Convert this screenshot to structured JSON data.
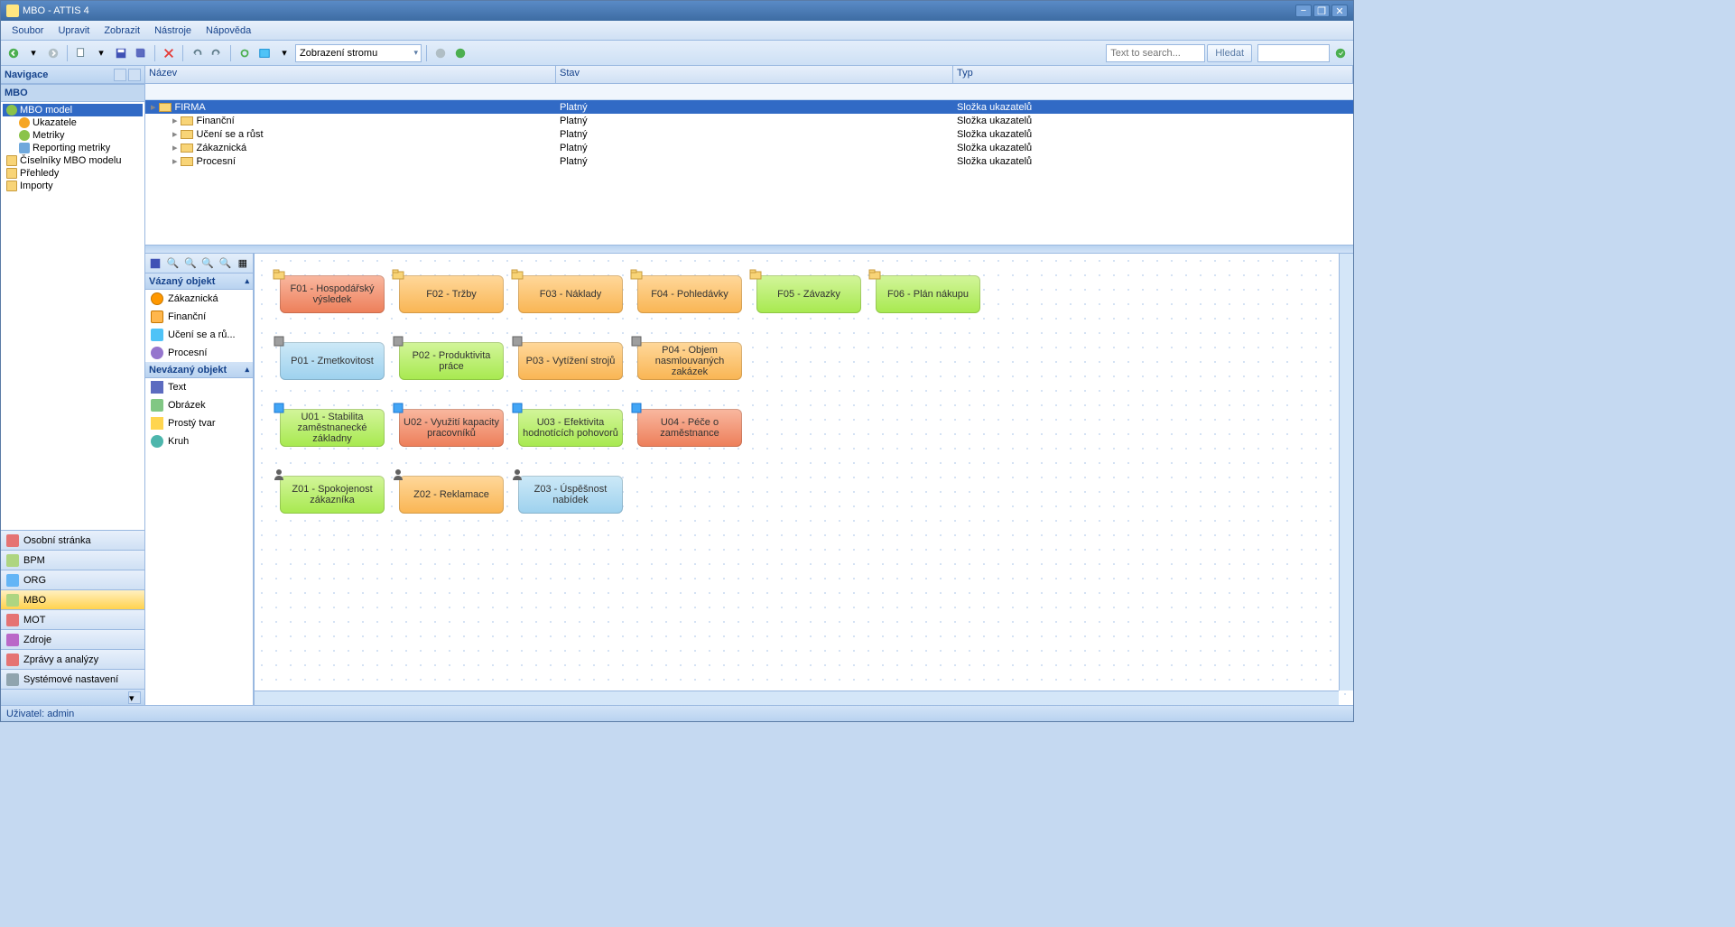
{
  "title": "MBO - ATTIS 4",
  "menu": [
    "Soubor",
    "Upravit",
    "Zobrazit",
    "Nástroje",
    "Nápověda"
  ],
  "toolbar": {
    "view_select": "Zobrazení stromu",
    "search_placeholder": "Text to search...",
    "search_btn": "Hledat"
  },
  "nav": {
    "title": "Navigace",
    "section": "MBO",
    "tree": [
      {
        "label": "MBO model",
        "selected": true,
        "indent": 0,
        "icon": "grn"
      },
      {
        "label": "Ukazatele",
        "indent": 1,
        "icon": "org"
      },
      {
        "label": "Metriky",
        "indent": 1,
        "icon": "grn"
      },
      {
        "label": "Reporting metriky",
        "indent": 1,
        "icon": "blu"
      },
      {
        "label": "Číselníky MBO modelu",
        "indent": 0,
        "icon": "fld"
      },
      {
        "label": "Přehledy",
        "indent": 0,
        "icon": "fld"
      },
      {
        "label": "Importy",
        "indent": 0,
        "icon": "fld"
      }
    ],
    "buttons": [
      {
        "label": "Osobní stránka",
        "icon": "r"
      },
      {
        "label": "BPM",
        "icon": "g"
      },
      {
        "label": "ORG",
        "icon": "b"
      },
      {
        "label": "MBO",
        "icon": "g",
        "selected": true
      },
      {
        "label": "MOT",
        "icon": "r"
      },
      {
        "label": "Zdroje",
        "icon": "p"
      },
      {
        "label": "Zprávy a analýzy",
        "icon": "r"
      },
      {
        "label": "Systémové nastavení",
        "icon": "gr"
      }
    ]
  },
  "grid": {
    "cols": [
      "Název",
      "Stav",
      "Typ"
    ],
    "rows": [
      {
        "name": "FIRMA",
        "stav": "Platný",
        "typ": "Složka ukazatelů",
        "indent": 0,
        "selected": true
      },
      {
        "name": "Finanční",
        "stav": "Platný",
        "typ": "Složka ukazatelů",
        "indent": 1
      },
      {
        "name": "Učení se a růst",
        "stav": "Platný",
        "typ": "Složka ukazatelů",
        "indent": 1
      },
      {
        "name": "Zákaznická",
        "stav": "Platný",
        "typ": "Složka ukazatelů",
        "indent": 1
      },
      {
        "name": "Procesní",
        "stav": "Platný",
        "typ": "Složka ukazatelů",
        "indent": 1
      }
    ]
  },
  "toolbox": {
    "bound_title": "Vázaný objekt",
    "bound": [
      "Zákaznická",
      "Finanční",
      "Učení se a rů...",
      "Procesní"
    ],
    "unbound_title": "Nevázaný objekt",
    "unbound": [
      "Text",
      "Obrázek",
      "Prostý tvar",
      "Kruh"
    ]
  },
  "cards": [
    {
      "label": "F01 - Hospodářský výsledek",
      "color": "c-red",
      "row": 0,
      "col": 0,
      "badge": "fld"
    },
    {
      "label": "F02 - Tržby",
      "color": "c-orange",
      "row": 0,
      "col": 1,
      "badge": "fld"
    },
    {
      "label": "F03 - Náklady",
      "color": "c-orange",
      "row": 0,
      "col": 2,
      "badge": "fld"
    },
    {
      "label": "F04 - Pohledávky",
      "color": "c-orange",
      "row": 0,
      "col": 3,
      "badge": "fld"
    },
    {
      "label": "F05 - Závazky",
      "color": "c-green",
      "row": 0,
      "col": 4,
      "badge": "fld"
    },
    {
      "label": "F06 - Plán nákupu",
      "color": "c-green",
      "row": 0,
      "col": 5,
      "badge": "fld"
    },
    {
      "label": "P01 - Zmetkovitost",
      "color": "c-blue",
      "row": 1,
      "col": 0,
      "badge": "box"
    },
    {
      "label": "P02 - Produktivita práce",
      "color": "c-green",
      "row": 1,
      "col": 1,
      "badge": "box"
    },
    {
      "label": "P03 - Vytížení strojů",
      "color": "c-orange",
      "row": 1,
      "col": 2,
      "badge": "box"
    },
    {
      "label": "P04 - Objem nasmlouvaných zakázek",
      "color": "c-orange",
      "row": 1,
      "col": 3,
      "badge": "box"
    },
    {
      "label": "U01 - Stabilita zaměstnanecké základny",
      "color": "c-green",
      "row": 2,
      "col": 0,
      "badge": "sq"
    },
    {
      "label": "U02 - Využití kapacity pracovníků",
      "color": "c-red",
      "row": 2,
      "col": 1,
      "badge": "sq"
    },
    {
      "label": "U03 - Efektivita hodnotících pohovorů",
      "color": "c-green",
      "row": 2,
      "col": 2,
      "badge": "sq"
    },
    {
      "label": "U04 - Péče o zaměstnance",
      "color": "c-red",
      "row": 2,
      "col": 3,
      "badge": "sq"
    },
    {
      "label": "Z01 - Spokojenost zákazníka",
      "color": "c-green",
      "row": 3,
      "col": 0,
      "badge": "person"
    },
    {
      "label": "Z02 - Reklamace",
      "color": "c-orange",
      "row": 3,
      "col": 1,
      "badge": "person"
    },
    {
      "label": "Z03 - Úspěšnost nabídek",
      "color": "c-blue",
      "row": 3,
      "col": 2,
      "badge": "person"
    }
  ],
  "status": "Uživatel: admin"
}
